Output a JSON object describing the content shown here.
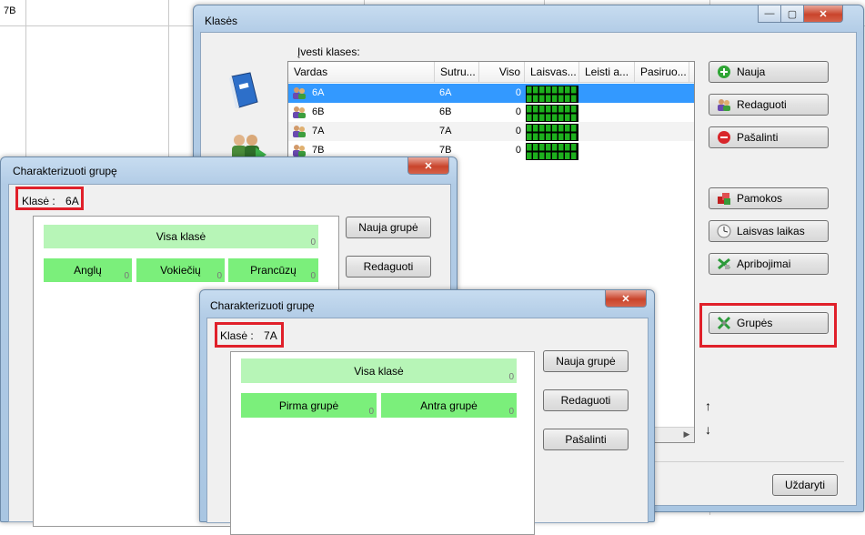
{
  "background": {
    "cell_label": "7B"
  },
  "main_window": {
    "title": "Klasės",
    "controls": {
      "minimize": "—",
      "maximize": "▢",
      "close": "✕"
    },
    "list_caption": "Įvesti klases:",
    "columns": [
      "Vardas",
      "Sutru...",
      "Viso",
      "Laisvas...",
      "Leisti a...",
      "Pasiruo..."
    ],
    "rows": [
      {
        "name": "6A",
        "short": "6A",
        "total": "0",
        "selected": true
      },
      {
        "name": "6B",
        "short": "6B",
        "total": "0",
        "selected": false
      },
      {
        "name": "7A",
        "short": "7A",
        "total": "0",
        "selected": false
      },
      {
        "name": "7B",
        "short": "7B",
        "total": "0",
        "selected": false
      }
    ],
    "buttons": {
      "new": "Nauja",
      "edit": "Redaguoti",
      "remove": "Pašalinti",
      "lessons": "Pamokos",
      "free_time": "Laisvas laikas",
      "constraints": "Apribojimai",
      "groups": "Grupės",
      "close": "Uždaryti"
    },
    "arrows": {
      "up": "↑",
      "down": "↓"
    }
  },
  "dialog1": {
    "title": "Charakterizuoti grupę",
    "class_label": "Klasė :",
    "class_value": "6A",
    "whole_class": {
      "label": "Visa klasė",
      "count": "0"
    },
    "groups": [
      {
        "label": "Anglų",
        "count": "0"
      },
      {
        "label": "Vokiečių",
        "count": "0"
      },
      {
        "label": "Prancūzų",
        "count": "0"
      }
    ],
    "buttons": {
      "new_group": "Nauja grupė",
      "edit": "Redaguoti"
    },
    "close": "✕"
  },
  "dialog2": {
    "title": "Charakterizuoti grupę",
    "class_label": "Klasė :",
    "class_value": "7A",
    "whole_class": {
      "label": "Visa klasė",
      "count": "0"
    },
    "groups": [
      {
        "label": "Pirma grupė",
        "count": "0"
      },
      {
        "label": "Antra grupė",
        "count": "0"
      }
    ],
    "buttons": {
      "new_group": "Nauja grupė",
      "edit": "Redaguoti",
      "remove": "Pašalinti"
    },
    "close": "✕"
  }
}
